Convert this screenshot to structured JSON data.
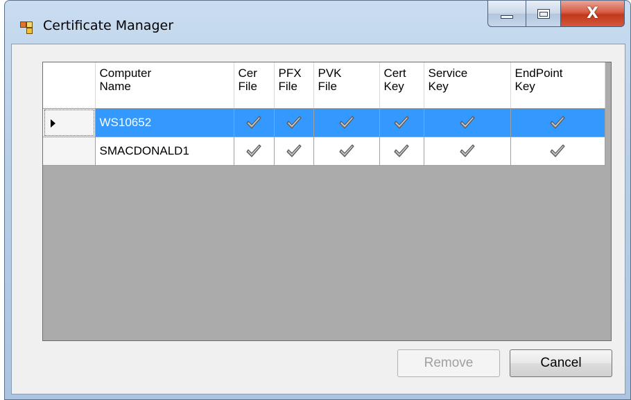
{
  "window": {
    "title": "Certificate Manager",
    "close_glyph": "X"
  },
  "grid": {
    "columns": [
      {
        "key": "computer_name",
        "label": "Computer\nName"
      },
      {
        "key": "cer_file",
        "label": "Cer\nFile"
      },
      {
        "key": "pfx_file",
        "label": "PFX\nFile"
      },
      {
        "key": "pvk_file",
        "label": "PVK\nFile"
      },
      {
        "key": "cert_key",
        "label": "Cert\nKey"
      },
      {
        "key": "service_key",
        "label": "Service\nKey"
      },
      {
        "key": "endpoint_key",
        "label": "EndPoint\nKey"
      }
    ],
    "rows": [
      {
        "computer_name": "WS10652",
        "cer_file": true,
        "pfx_file": true,
        "pvk_file": true,
        "cert_key": true,
        "service_key": true,
        "endpoint_key": true,
        "selected": true
      },
      {
        "computer_name": "SMACDONALD1",
        "cer_file": true,
        "pfx_file": true,
        "pvk_file": true,
        "cert_key": true,
        "service_key": true,
        "endpoint_key": true,
        "selected": false
      }
    ]
  },
  "buttons": {
    "remove_label": "Remove",
    "remove_enabled": false,
    "cancel_label": "Cancel"
  },
  "colors": {
    "selection": "#3399ff",
    "grid_background": "#ababab",
    "close_button": "#c7472b"
  }
}
